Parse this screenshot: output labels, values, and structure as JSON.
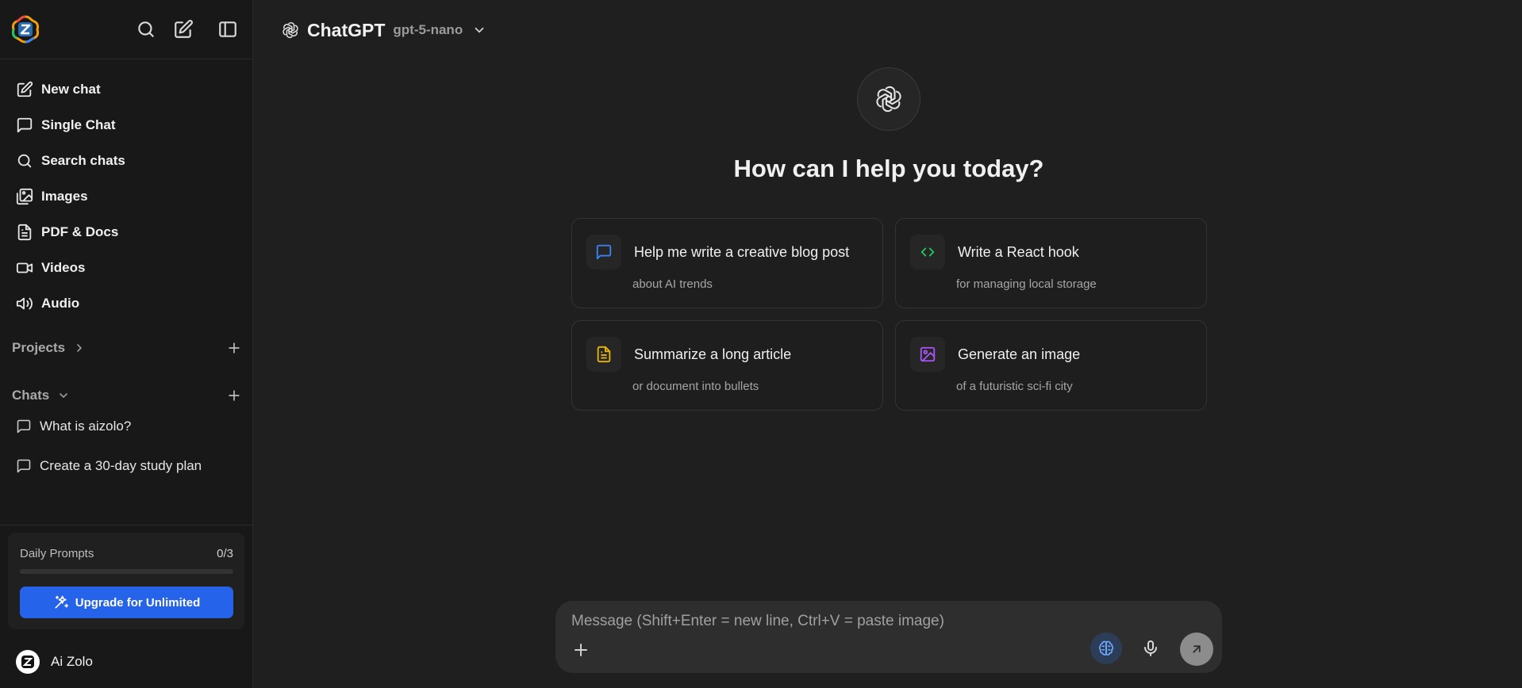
{
  "sidebar": {
    "top_icons": [
      "search-icon",
      "compose-icon",
      "sidebar-toggle-icon"
    ],
    "nav": [
      {
        "label": "New chat",
        "icon": "compose-icon"
      },
      {
        "label": "Single Chat",
        "icon": "chat-bubble-icon"
      },
      {
        "label": "Search chats",
        "icon": "search-icon"
      },
      {
        "label": "Images",
        "icon": "images-icon"
      },
      {
        "label": "PDF & Docs",
        "icon": "document-icon"
      },
      {
        "label": "Videos",
        "icon": "video-icon"
      },
      {
        "label": "Audio",
        "icon": "audio-icon"
      }
    ],
    "projects_label": "Projects",
    "chats_label": "Chats",
    "chats": [
      {
        "label": "What is aizolo?"
      },
      {
        "label": "Create a 30-day study plan"
      }
    ],
    "daily": {
      "label": "Daily Prompts",
      "count": "0/3",
      "progress": 0
    },
    "upgrade_label": "Upgrade for Unlimited",
    "user_name": "Ai Zolo"
  },
  "header": {
    "title": "ChatGPT",
    "model": "gpt-5-nano"
  },
  "main": {
    "greeting": "How can I help you today?",
    "cards": [
      {
        "title": "Help me write a creative blog post",
        "subtitle": "about AI trends",
        "icon": "chat-bubble-icon",
        "color": "#3b82f6"
      },
      {
        "title": "Write a React hook",
        "subtitle": "for managing local storage",
        "icon": "code-icon",
        "color": "#22c55e"
      },
      {
        "title": "Summarize a long article",
        "subtitle": "or document into bullets",
        "icon": "document-icon",
        "color": "#eab308"
      },
      {
        "title": "Generate an image",
        "subtitle": "of a futuristic sci-fi city",
        "icon": "image-icon",
        "color": "#a855f7"
      }
    ]
  },
  "composer": {
    "placeholder": "Message (Shift+Enter = new line, Ctrl+V = paste image)",
    "value": ""
  },
  "colors": {
    "accent": "#2563eb",
    "background": "#1f1f1f",
    "sidebar": "#181818"
  }
}
